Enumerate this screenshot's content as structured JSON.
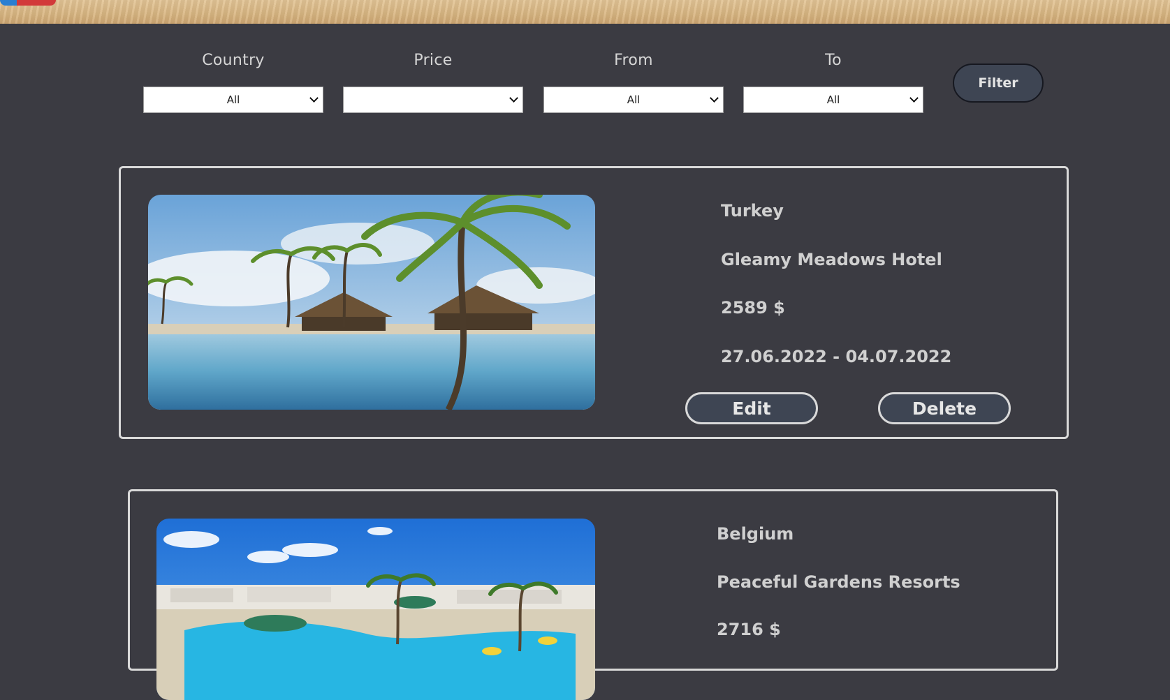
{
  "filters": {
    "country": {
      "label": "Country",
      "value": "All"
    },
    "price": {
      "label": "Price",
      "value": ""
    },
    "from": {
      "label": "From",
      "value": "All"
    },
    "to": {
      "label": "To",
      "value": "All"
    },
    "button_label": "Filter"
  },
  "offers": [
    {
      "country": "Turkey",
      "hotel": "Gleamy Meadows Hotel",
      "price": "2589 $",
      "dates": "27.06.2022 - 04.07.2022",
      "edit_label": "Edit",
      "delete_label": "Delete"
    },
    {
      "country": "Belgium",
      "hotel": "Peaceful Gardens Resorts",
      "price": "2716 $"
    }
  ],
  "colors": {
    "background": "#3b3b42",
    "button_fill": "#3e4553",
    "card_border": "#d9d9d9",
    "text": "#d0d0d0"
  }
}
